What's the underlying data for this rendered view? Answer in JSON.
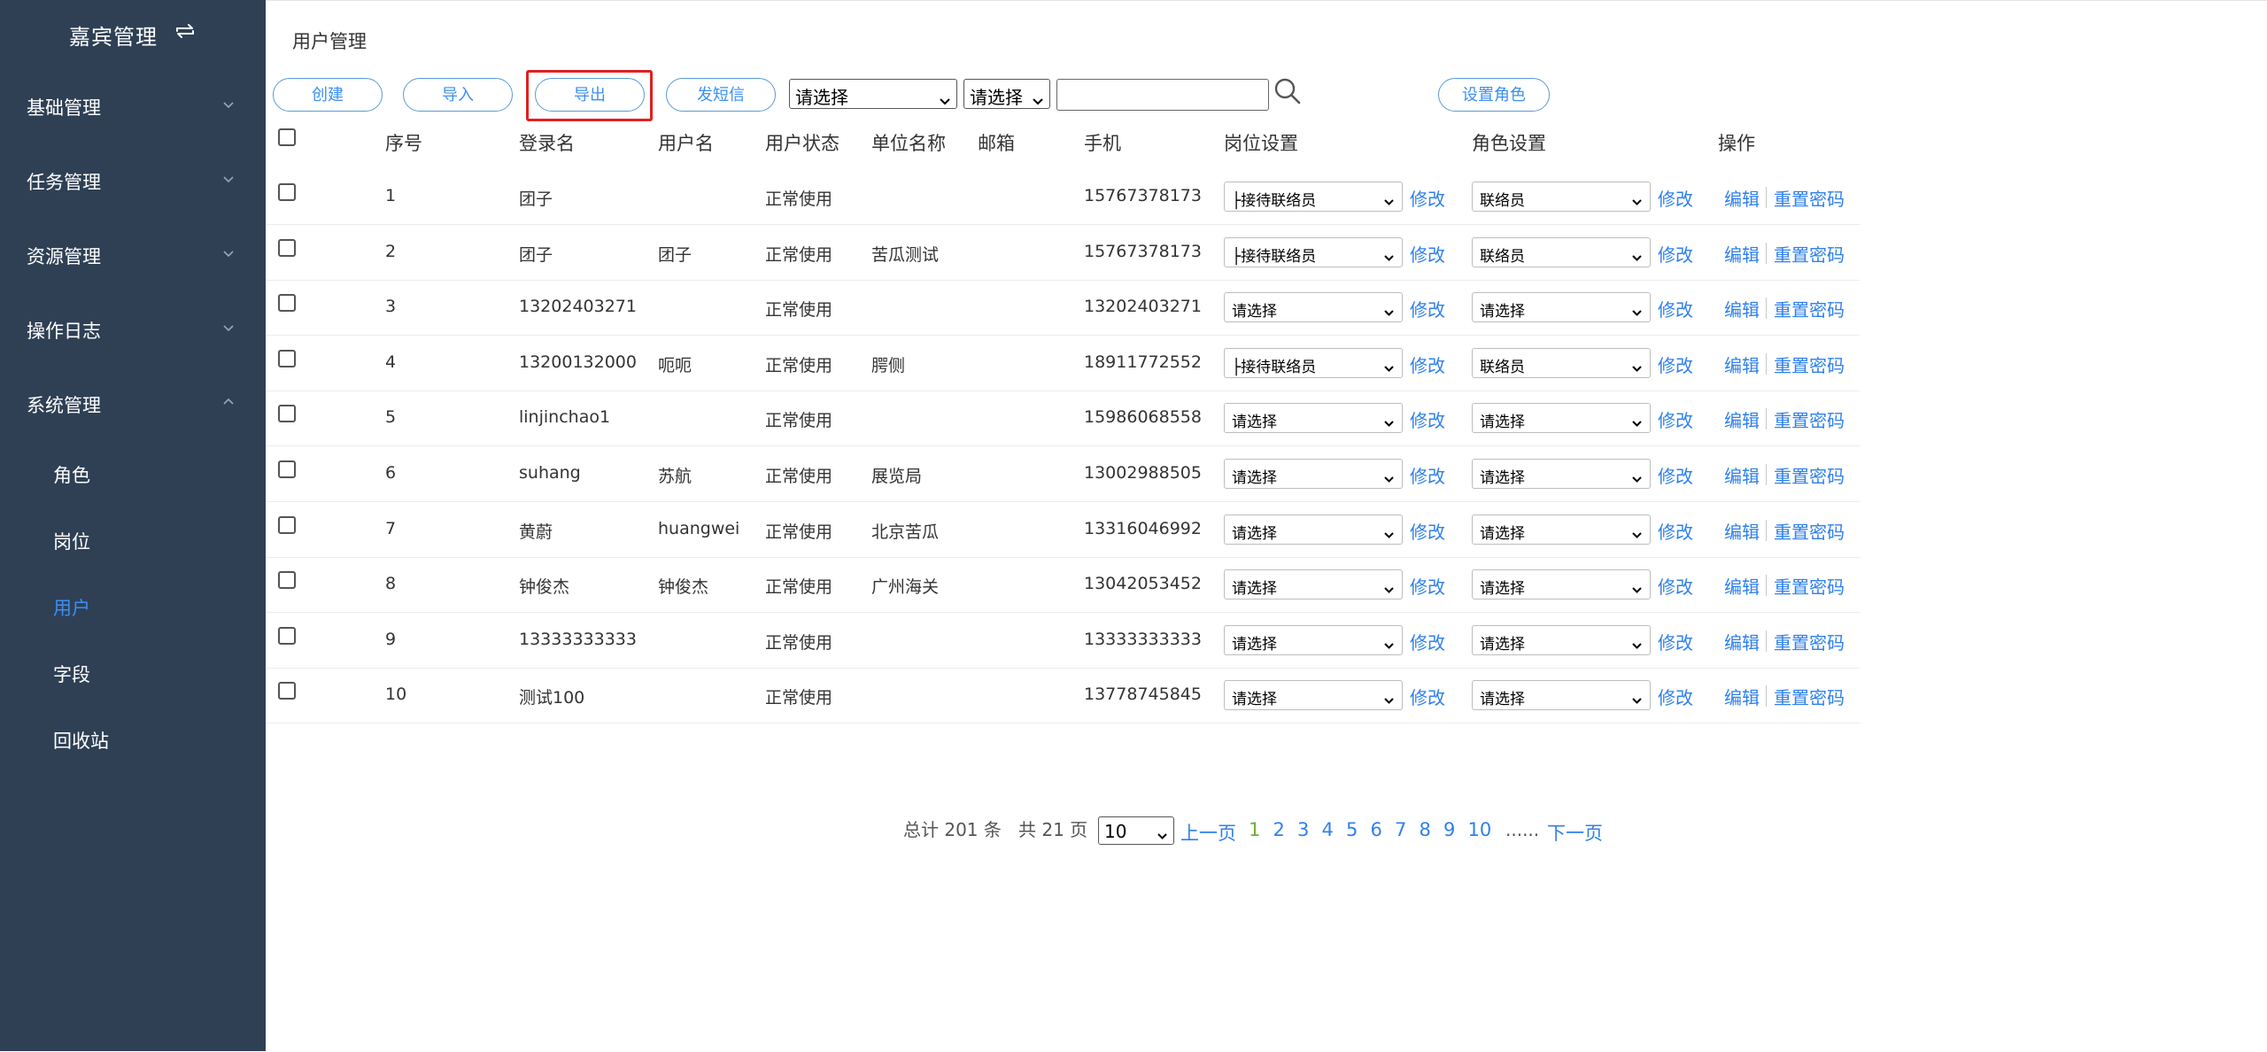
{
  "sidebar": {
    "brand_title": "嘉宾管理",
    "groups": [
      {
        "label": "基础管理",
        "expanded": false
      },
      {
        "label": "任务管理",
        "expanded": false
      },
      {
        "label": "资源管理",
        "expanded": false
      },
      {
        "label": "操作日志",
        "expanded": false
      },
      {
        "label": "系统管理",
        "expanded": true
      }
    ],
    "sub_items": [
      {
        "label": "角色",
        "active": false
      },
      {
        "label": "岗位",
        "active": false
      },
      {
        "label": "用户",
        "active": true
      },
      {
        "label": "字段",
        "active": false
      },
      {
        "label": "回收站",
        "active": false
      }
    ],
    "colors": {
      "background": "#2f4055",
      "active_text": "#3b8ff2"
    }
  },
  "page_title": "用户管理",
  "toolbar": {
    "create_label": "创建",
    "import_label": "导入",
    "export_label": "导出",
    "sms_label": "发短信",
    "filter1_value": "请选择",
    "filter2_value": "请选择",
    "search_value": "",
    "set_role_label": "设置角色",
    "highlighted": "export"
  },
  "table": {
    "headers": {
      "index": "序号",
      "login": "登录名",
      "username": "用户名",
      "status": "用户状态",
      "unit": "单位名称",
      "email": "邮箱",
      "phone": "手机",
      "position": "岗位设置",
      "role": "角色设置",
      "actions": "操作"
    },
    "action_labels": {
      "modify": "修改",
      "edit": "编辑",
      "reset_password": "重置密码"
    },
    "rows": [
      {
        "index": "1",
        "login": "团子",
        "username": "",
        "status": "正常使用",
        "unit": "",
        "email": "",
        "phone": "15767378173",
        "position": "├接待联络员",
        "role": "联络员"
      },
      {
        "index": "2",
        "login": "团子",
        "username": "团子",
        "status": "正常使用",
        "unit": "苦瓜测试",
        "email": "",
        "phone": "15767378173",
        "position": "├接待联络员",
        "role": "联络员"
      },
      {
        "index": "3",
        "login": "13202403271",
        "username": "",
        "status": "正常使用",
        "unit": "",
        "email": "",
        "phone": "13202403271",
        "position": "请选择",
        "role": "请选择"
      },
      {
        "index": "4",
        "login": "13200132000",
        "username": "呃呃",
        "status": "正常使用",
        "unit": "腭侧",
        "email": "",
        "phone": "18911772552",
        "position": "├接待联络员",
        "role": "联络员"
      },
      {
        "index": "5",
        "login": "linjinchao1",
        "username": "",
        "status": "正常使用",
        "unit": "",
        "email": "",
        "phone": "15986068558",
        "position": "请选择",
        "role": "请选择"
      },
      {
        "index": "6",
        "login": "suhang",
        "username": "苏航",
        "status": "正常使用",
        "unit": "展览局",
        "email": "",
        "phone": "13002988505",
        "position": "请选择",
        "role": "请选择"
      },
      {
        "index": "7",
        "login": "黄蔚",
        "username": "huangwei",
        "status": "正常使用",
        "unit": "北京苦瓜",
        "email": "",
        "phone": "13316046992",
        "position": "请选择",
        "role": "请选择"
      },
      {
        "index": "8",
        "login": "钟俊杰",
        "username": "钟俊杰",
        "status": "正常使用",
        "unit": "广州海关",
        "email": "",
        "phone": "13042053452",
        "position": "请选择",
        "role": "请选择"
      },
      {
        "index": "9",
        "login": "13333333333",
        "username": "",
        "status": "正常使用",
        "unit": "",
        "email": "",
        "phone": "13333333333",
        "position": "请选择",
        "role": "请选择"
      },
      {
        "index": "10",
        "login": "测试100",
        "username": "",
        "status": "正常使用",
        "unit": "",
        "email": "",
        "phone": "13778745845",
        "position": "请选择",
        "role": "请选择"
      }
    ]
  },
  "pagination": {
    "total_text": "总计 201 条",
    "pages_text": "共 21 页",
    "page_size": "10",
    "prev_label": "上一页",
    "next_label": "下一页",
    "pages": [
      "1",
      "2",
      "3",
      "4",
      "5",
      "6",
      "7",
      "8",
      "9",
      "10"
    ],
    "current_page": "1",
    "ellipsis": "......"
  }
}
